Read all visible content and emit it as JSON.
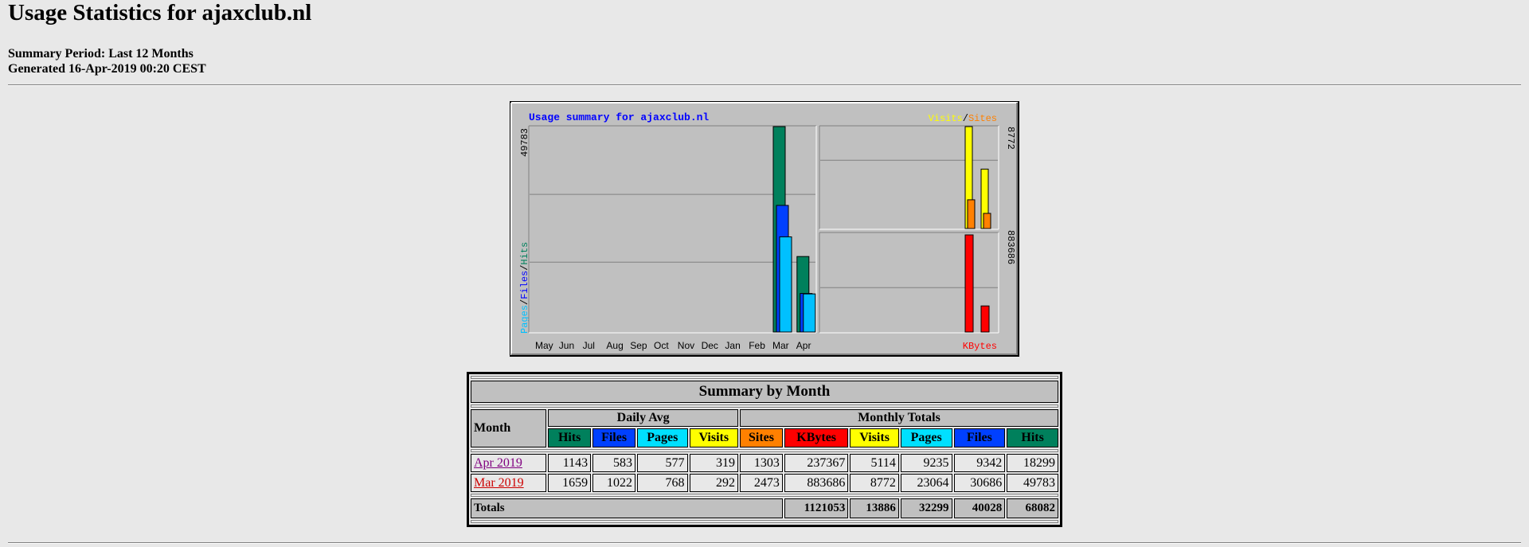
{
  "page": {
    "title": "Usage Statistics for ajaxclub.nl",
    "summary_period": "Summary Period: Last 12 Months",
    "generated": "Generated 16-Apr-2019 00:20 CEST"
  },
  "graph": {
    "title": "Usage summary for ajaxclub.nl",
    "left_axis_max": "49783",
    "right_top_axis_max": "8772",
    "right_bottom_axis_max": "883686",
    "legend_left": [
      "Pages",
      "/",
      "Files",
      "/",
      "Hits"
    ],
    "legend_top_right": [
      "Visits",
      "/",
      "Sites"
    ],
    "legend_bottom_right": "KBytes",
    "months": [
      "May",
      "Jun",
      "Jul",
      "Aug",
      "Sep",
      "Oct",
      "Nov",
      "Dec",
      "Jan",
      "Feb",
      "Mar",
      "Apr"
    ]
  },
  "chart_data": {
    "type": "bar",
    "title": "Usage summary for ajaxclub.nl",
    "categories": [
      "May",
      "Jun",
      "Jul",
      "Aug",
      "Sep",
      "Oct",
      "Nov",
      "Dec",
      "Jan",
      "Feb",
      "Mar",
      "Apr"
    ],
    "panels": [
      {
        "name": "main",
        "ylim": [
          0,
          49783
        ],
        "series": [
          {
            "name": "Hits",
            "color": "#00805c",
            "values": [
              0,
              0,
              0,
              0,
              0,
              0,
              0,
              0,
              0,
              0,
              49783,
              18299
            ]
          },
          {
            "name": "Files",
            "color": "#0040ff",
            "values": [
              0,
              0,
              0,
              0,
              0,
              0,
              0,
              0,
              0,
              0,
              30686,
              9342
            ]
          },
          {
            "name": "Pages",
            "color": "#00c0ff",
            "values": [
              0,
              0,
              0,
              0,
              0,
              0,
              0,
              0,
              0,
              0,
              23064,
              9235
            ]
          }
        ]
      },
      {
        "name": "visits-sites",
        "ylim": [
          0,
          8772
        ],
        "series": [
          {
            "name": "Visits",
            "color": "#ffff00",
            "values": [
              0,
              0,
              0,
              0,
              0,
              0,
              0,
              0,
              0,
              0,
              8772,
              5114
            ]
          },
          {
            "name": "Sites",
            "color": "#ff8000",
            "values": [
              0,
              0,
              0,
              0,
              0,
              0,
              0,
              0,
              0,
              0,
              2473,
              1303
            ]
          }
        ]
      },
      {
        "name": "kbytes",
        "ylim": [
          0,
          883686
        ],
        "series": [
          {
            "name": "KBytes",
            "color": "#ff0000",
            "values": [
              0,
              0,
              0,
              0,
              0,
              0,
              0,
              0,
              0,
              0,
              883686,
              237367
            ]
          }
        ]
      }
    ]
  },
  "summary": {
    "title": "Summary by Month",
    "month_header": "Month",
    "daily_avg": "Daily Avg",
    "monthly_totals": "Monthly Totals",
    "daily_cols": [
      "Hits",
      "Files",
      "Pages",
      "Visits"
    ],
    "monthly_cols": [
      "Sites",
      "KBytes",
      "Visits",
      "Pages",
      "Files",
      "Hits"
    ],
    "rows": [
      {
        "month": "Apr 2019",
        "values": [
          "1143",
          "583",
          "577",
          "319",
          "1303",
          "237367",
          "5114",
          "9235",
          "9342",
          "18299"
        ]
      },
      {
        "month": "Mar 2019",
        "values": [
          "1659",
          "1022",
          "768",
          "292",
          "2473",
          "883686",
          "8772",
          "23064",
          "30686",
          "49783"
        ]
      }
    ],
    "totals_label": "Totals",
    "totals": [
      "1121053",
      "13886",
      "32299",
      "40028",
      "68082"
    ]
  },
  "colors": {
    "hits": "#00805c",
    "files": "#0040ff",
    "pages": "#00e0ff",
    "visits": "#ffff00",
    "sites": "#ff8000",
    "kbytes": "#ff0000",
    "background": "#e8e8e8",
    "panel": "#c0c0c0"
  }
}
